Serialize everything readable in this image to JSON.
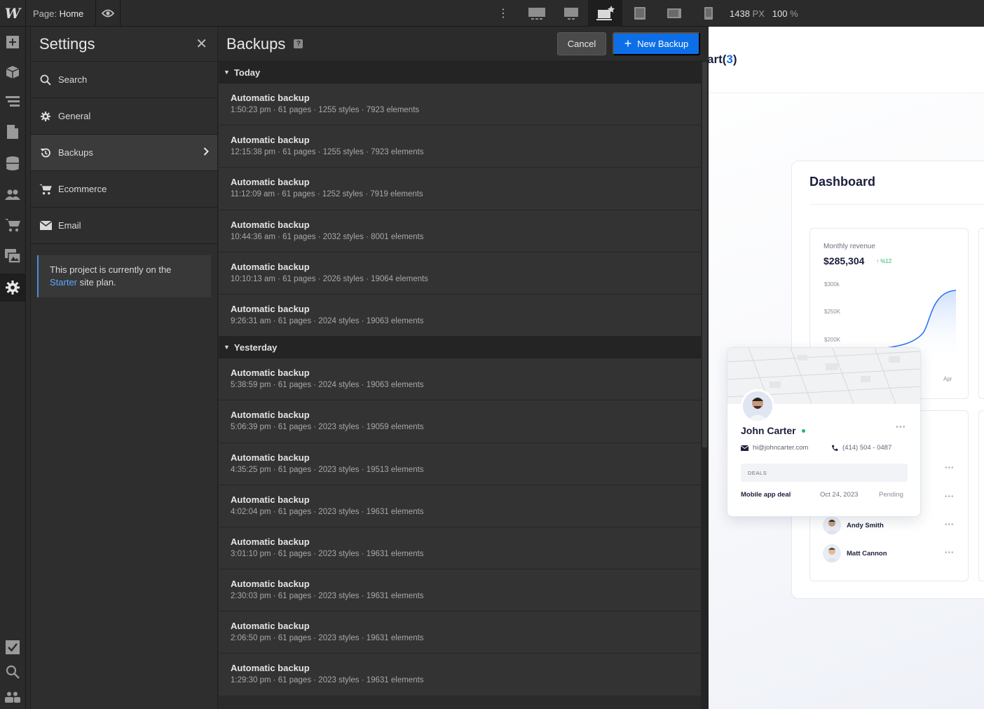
{
  "topbar": {
    "logo": "W",
    "page_prefix": "Page:",
    "page_name": "Home",
    "width_value": "1438",
    "width_unit": "PX",
    "zoom_value": "100",
    "zoom_unit": "%"
  },
  "settings": {
    "title": "Settings",
    "items": [
      {
        "label": "Search",
        "icon": "search-icon"
      },
      {
        "label": "General",
        "icon": "gear-icon"
      },
      {
        "label": "Backups",
        "icon": "restore-icon"
      },
      {
        "label": "Ecommerce",
        "icon": "cart-icon"
      },
      {
        "label": "Email",
        "icon": "mail-icon"
      }
    ],
    "plan_note": {
      "prefix": "This project is currently on the",
      "plan": "Starter",
      "suffix": "site plan."
    }
  },
  "backups": {
    "title": "Backups",
    "help": "?",
    "cancel_label": "Cancel",
    "new_label": "New Backup",
    "groups": [
      {
        "label": "Today",
        "rows": [
          {
            "title": "Automatic backup",
            "meta": "1:50:23 pm · 61 pages · 1255 styles · 7923 elements"
          },
          {
            "title": "Automatic backup",
            "meta": "12:15:38 pm · 61 pages · 1255 styles · 7923 elements"
          },
          {
            "title": "Automatic backup",
            "meta": "11:12:09 am · 61 pages · 1252 styles · 7919 elements"
          },
          {
            "title": "Automatic backup",
            "meta": "10:44:36 am · 61 pages · 2032 styles · 8001 elements"
          },
          {
            "title": "Automatic backup",
            "meta": "10:10:13 am · 61 pages · 2026 styles · 19064 elements"
          },
          {
            "title": "Automatic backup",
            "meta": "9:26:31 am · 61 pages · 2024 styles · 19063 elements"
          }
        ]
      },
      {
        "label": "Yesterday",
        "rows": [
          {
            "title": "Automatic backup",
            "meta": "5:38:59 pm · 61 pages · 2024 styles · 19063 elements"
          },
          {
            "title": "Automatic backup",
            "meta": "5:06:39 pm · 61 pages · 2023 styles · 19059 elements"
          },
          {
            "title": "Automatic backup",
            "meta": "4:35:25 pm · 61 pages · 2023 styles · 19513 elements"
          },
          {
            "title": "Automatic backup",
            "meta": "4:02:04 pm · 61 pages · 2023 styles · 19631 elements"
          },
          {
            "title": "Automatic backup",
            "meta": "3:01:10 pm · 61 pages · 2023 styles · 19631 elements"
          },
          {
            "title": "Automatic backup",
            "meta": "2:30:03 pm · 61 pages · 2023 styles · 19631 elements"
          },
          {
            "title": "Automatic backup",
            "meta": "2:06:50 pm · 61 pages · 2023 styles · 19631 elements"
          },
          {
            "title": "Automatic backup",
            "meta": "1:29:30 pm · 61 pages · 2023 styles · 19631 elements"
          }
        ]
      }
    ]
  },
  "canvas": {
    "cart_prefix": "art(",
    "cart_count": "3",
    "cart_suffix": ")",
    "dashboard_title": "Dashboard",
    "revenue_label": "Monthly revenue",
    "revenue_value": "$285,304",
    "revenue_delta": "↑ %12",
    "revenue_ticks": [
      "$300k",
      "$250K",
      "$200K"
    ],
    "revenue_month": "Apr",
    "contact": {
      "name": "John Carter",
      "email": "hi@johncarter.com",
      "phone": "(414) 504 - 0487",
      "deals_label": "DEALS",
      "deal_name": "Mobile app deal",
      "deal_date": "Oct 24, 2023",
      "deal_status": "Pending"
    },
    "people": [
      "Andy Smith",
      "Matt Cannon"
    ]
  },
  "colors": {
    "accent": "#0d6fe8",
    "link": "#5aa8ff",
    "online": "#1fb86b"
  }
}
